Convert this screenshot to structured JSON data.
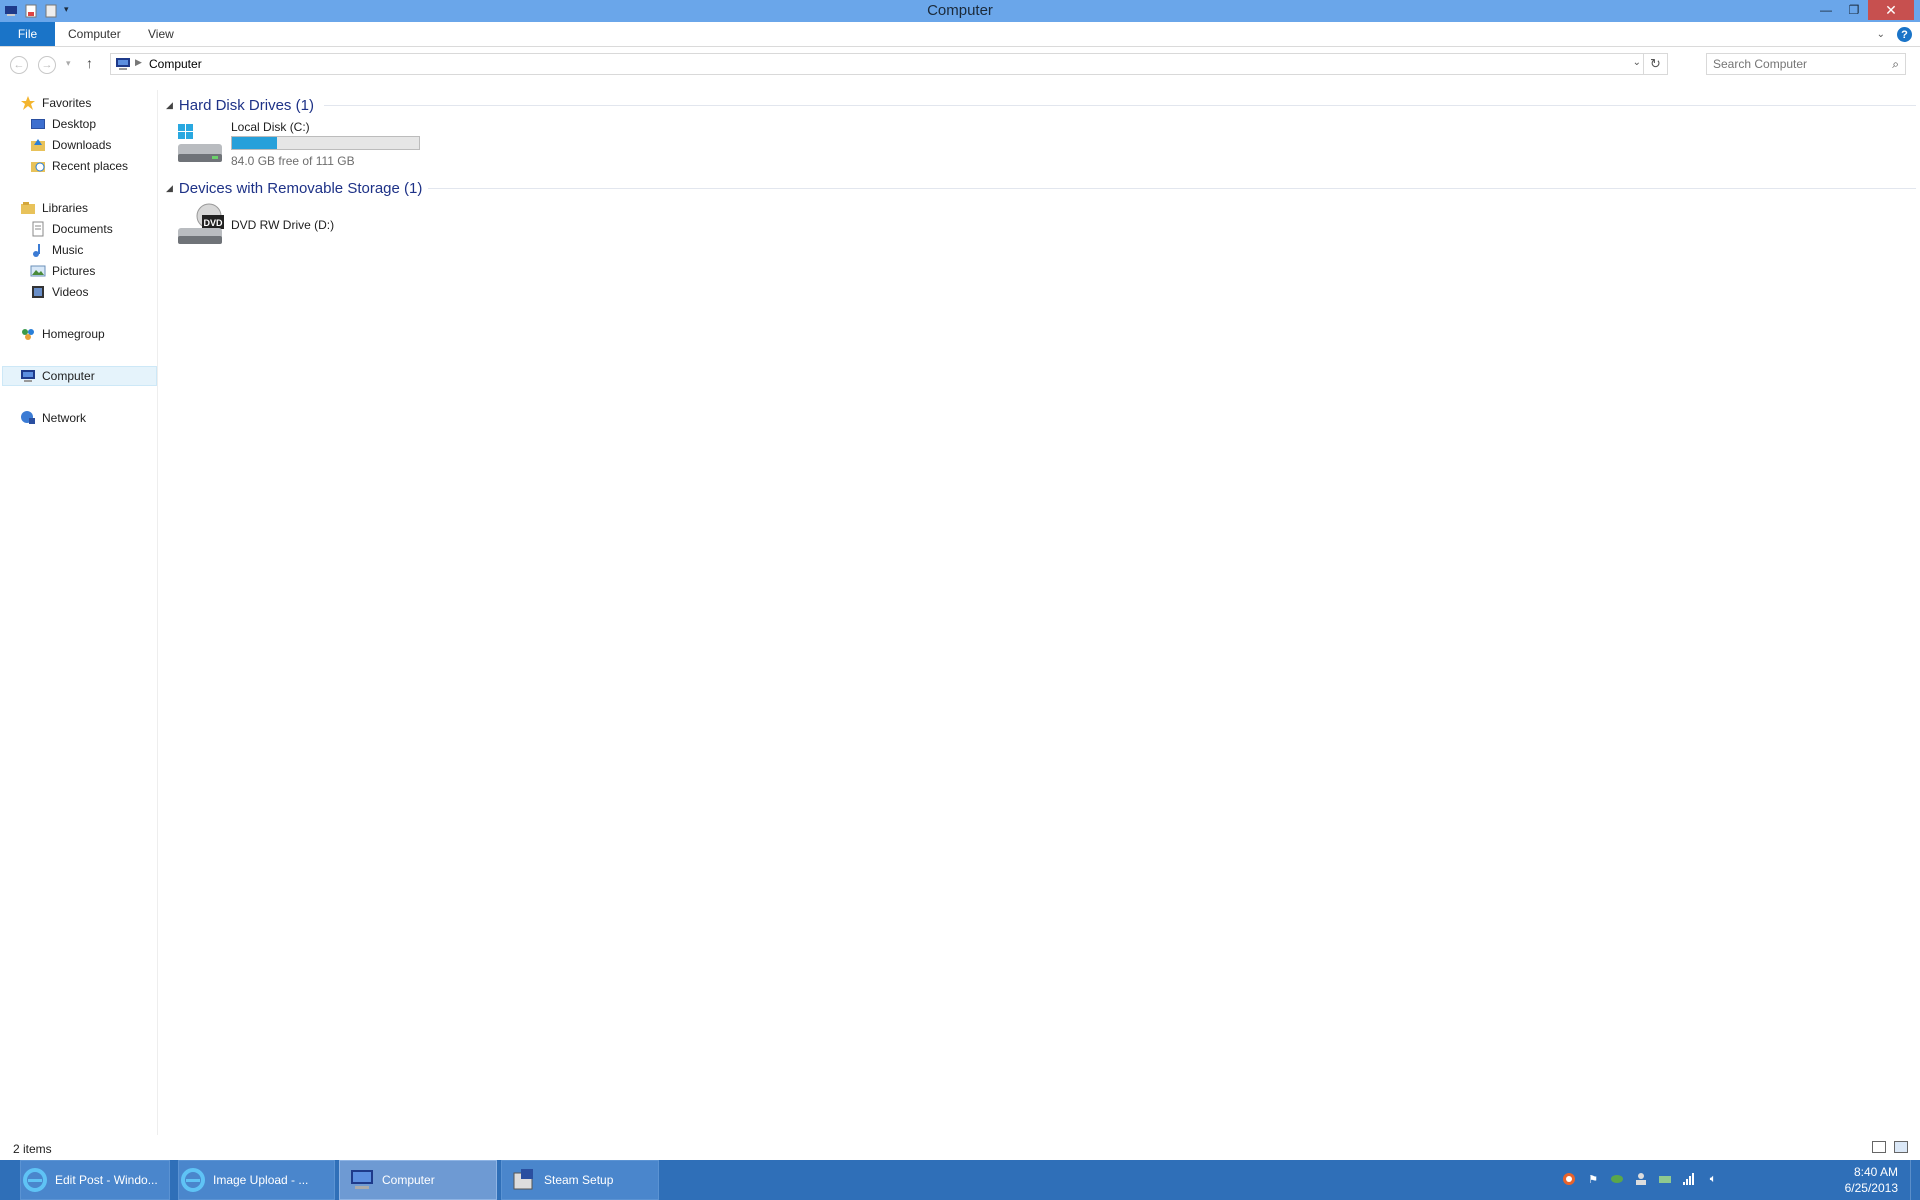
{
  "window": {
    "title": "Computer"
  },
  "ribbon": {
    "file": "File",
    "tabs": [
      "Computer",
      "View"
    ]
  },
  "address": {
    "crumb": "Computer",
    "search_placeholder": "Search Computer"
  },
  "nav": {
    "favorites": "Favorites",
    "favorites_items": [
      "Desktop",
      "Downloads",
      "Recent places"
    ],
    "libraries": "Libraries",
    "libraries_items": [
      "Documents",
      "Music",
      "Pictures",
      "Videos"
    ],
    "homegroup": "Homegroup",
    "computer": "Computer",
    "network": "Network"
  },
  "groups": [
    {
      "name": "Hard Disk Drives (1)"
    },
    {
      "name": "Devices with Removable Storage (1)"
    }
  ],
  "drives": {
    "c": {
      "name": "Local Disk (C:)",
      "free_text": "84.0 GB free of 111 GB",
      "used_fraction": 0.243
    },
    "d": {
      "name": "DVD RW Drive (D:)",
      "icon_label": "DVD"
    }
  },
  "status": {
    "count": "2 items"
  },
  "taskbar": {
    "items": [
      "Edit Post - Windo...",
      "Image Upload - ...",
      "Computer",
      "Steam Setup"
    ],
    "time": "8:40 AM",
    "date": "6/25/2013"
  },
  "colors": {
    "titlebar": "#6aa6ea",
    "file_tab": "#1a74c8",
    "taskbar": "#2f6fb8",
    "capacity_fill": "#26a0da",
    "close": "#c7504f"
  }
}
